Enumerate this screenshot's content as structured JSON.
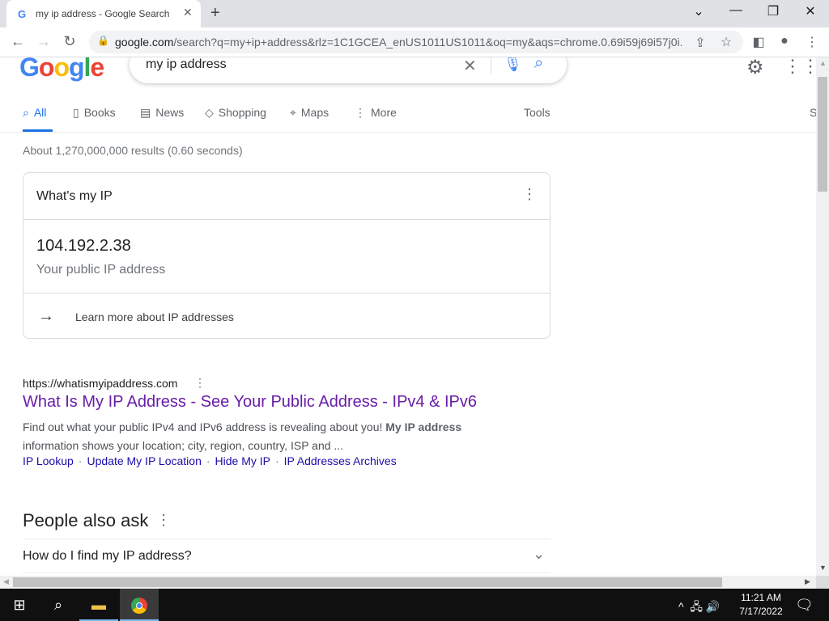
{
  "browser": {
    "tab_title": "my ip address - Google Search",
    "tab_favicon": "G",
    "url_host": "google.com",
    "url_rest": "/search?q=my+ip+address&rlz=1C1GCEA_enUS1011US1011&oq=my&aqs=chrome.0.69i59j69i57j0i..."
  },
  "google": {
    "query": "my ip address",
    "tabs": [
      {
        "label": "All"
      },
      {
        "label": "Books"
      },
      {
        "label": "News"
      },
      {
        "label": "Shopping"
      },
      {
        "label": "Maps"
      },
      {
        "label": "More"
      }
    ],
    "tools_label": "Tools",
    "safesearch_label": "S",
    "stats": "About 1,270,000,000 results (0.60 seconds)"
  },
  "ip_card": {
    "heading": "What's my IP",
    "ip": "104.192.2.38",
    "subtitle": "Your public IP address",
    "learn_more": "Learn more about IP addresses"
  },
  "result": {
    "cite": "https://whatismyipaddress.com",
    "title": "What Is My IP Address - See Your Public Address - IPv4 & IPv6",
    "snippet_start": "Find out what your public IPv4 and IPv6 address is revealing about you! ",
    "snippet_bold": "My IP address",
    "snippet_end": "information shows your location; city, region, country, ISP and ...",
    "sitelinks": [
      "IP Lookup",
      "Update My IP Location",
      "Hide My IP",
      "IP Addresses Archives"
    ]
  },
  "paa": {
    "heading": "People also ask",
    "questions": [
      "How do I find my IP address?"
    ]
  },
  "taskbar": {
    "time": "11:21 AM",
    "date": "7/17/2022"
  }
}
